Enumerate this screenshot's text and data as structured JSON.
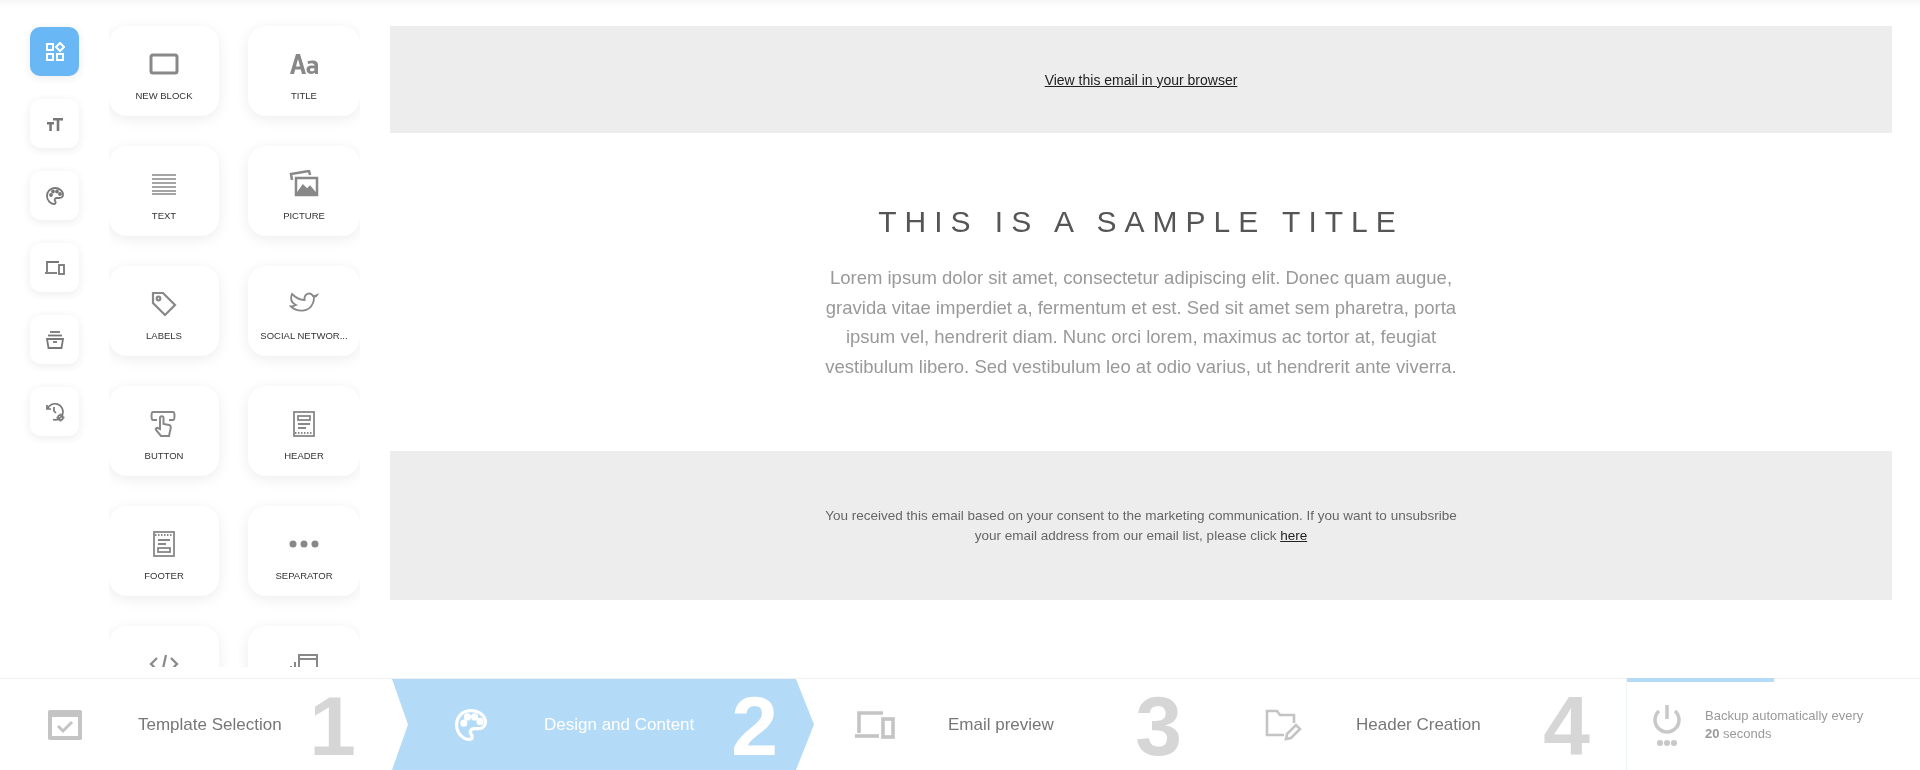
{
  "sidebar": {
    "items": [
      {
        "kind": "blocks",
        "selected": true
      },
      {
        "kind": "typography",
        "selected": false
      },
      {
        "kind": "palette",
        "selected": false
      },
      {
        "kind": "devices",
        "selected": false
      },
      {
        "kind": "archive",
        "selected": false
      },
      {
        "kind": "history",
        "selected": false
      }
    ]
  },
  "tiles": [
    {
      "kind": "block",
      "label": "NEW BLOCK"
    },
    {
      "kind": "title",
      "label": "TITLE"
    },
    {
      "kind": "text",
      "label": "TEXT"
    },
    {
      "kind": "picture",
      "label": "PICTURE"
    },
    {
      "kind": "labels",
      "label": "LABELS"
    },
    {
      "kind": "social",
      "label": "SOCIAL NETWOR..."
    },
    {
      "kind": "button",
      "label": "BUTTON"
    },
    {
      "kind": "header",
      "label": "HEADER"
    },
    {
      "kind": "footer",
      "label": "FOOTER"
    },
    {
      "kind": "separator",
      "label": "SEPARATOR"
    },
    {
      "kind": "code"
    },
    {
      "kind": "widget"
    }
  ],
  "email": {
    "browser_link": "View this email in your browser",
    "title": "THIS IS A SAMPLE TITLE",
    "body": "Lorem ipsum dolor sit amet, consectetur adipiscing elit. Donec quam augue, gravida vitae imperdiet a, fermentum et est. Sed sit amet sem pharetra, porta ipsum vel, hendrerit diam. Nunc orci lorem, maximus ac tortor at, feugiat vestibulum libero. Sed vestibulum leo at odio varius, ut hendrerit ante viverra.",
    "footer_text": "You received this email based on your consent to the marketing communication. If you want to unsubsribe your email address from our email list, please click",
    "footer_link": "here"
  },
  "steps": [
    {
      "kind": "template",
      "label": "Template Selection",
      "number": "1",
      "selected": false
    },
    {
      "kind": "design",
      "label": "Design and Content",
      "number": "2",
      "selected": true
    },
    {
      "kind": "preview",
      "label": "Email preview",
      "number": "3",
      "selected": false
    },
    {
      "kind": "header",
      "label": "Header Creation",
      "number": "4",
      "selected": false
    }
  ],
  "backup": {
    "text": "Backup automatically every **20** seconds",
    "level": 0.5
  }
}
